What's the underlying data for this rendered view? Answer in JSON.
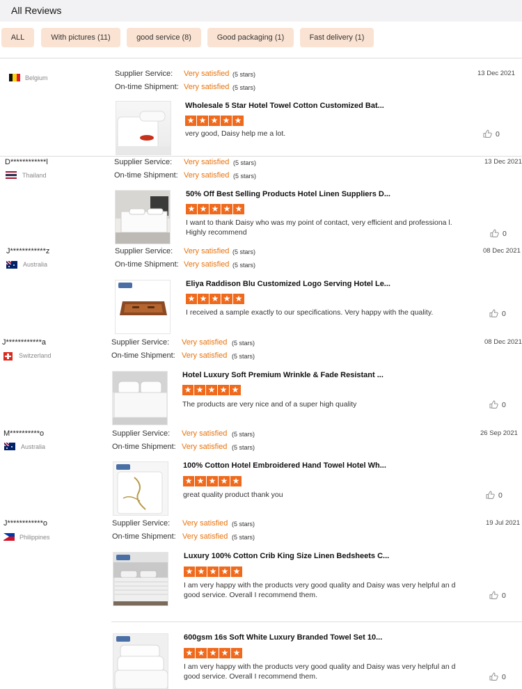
{
  "header": {
    "title": "All Reviews"
  },
  "filters": [
    {
      "label": "ALL"
    },
    {
      "label": "With pictures (11)"
    },
    {
      "label": "good service (8)"
    },
    {
      "label": "Good packaging (1)"
    },
    {
      "label": "Fast delivery (1)"
    }
  ],
  "labels": {
    "supplier_service": "Supplier Service:",
    "ontime_shipment": "On-time Shipment:"
  },
  "reviews": [
    {
      "user": "",
      "country": "Belgium",
      "supplier_rating": "Very satisfied",
      "supplier_stars": "(5 stars)",
      "shipment_rating": "Very satisfied",
      "shipment_stars": "(5 stars)",
      "date": "13 Dec 2021",
      "product_title": "Wholesale 5 Star Hotel Towel Cotton Customized Bat...",
      "review_text": "very good, Daisy help me a lot.",
      "likes": "0"
    },
    {
      "user": "D************l",
      "country": "Thailand",
      "supplier_rating": "Very satisfied",
      "supplier_stars": "(5 stars)",
      "shipment_rating": "Very satisfied",
      "shipment_stars": "(5 stars)",
      "date": "13 Dec 2021",
      "product_title": "50% Off Best Selling Products Hotel Linen Suppliers D...",
      "review_text": "I want to thank Daisy who was my point of contact, very efficient and professiona l. Highly recommend",
      "likes": "0"
    },
    {
      "user": "J************z",
      "country": "Australia",
      "supplier_rating": "Very satisfied",
      "supplier_stars": "(5 stars)",
      "shipment_rating": "Very satisfied",
      "shipment_stars": "(5 stars)",
      "date": "08 Dec 2021",
      "product_title": "Eliya Raddison Blu Customized Logo Serving Hotel Le...",
      "review_text": "I received a sample exactly to our specifications. Very happy with the quality.",
      "likes": "0"
    },
    {
      "user": "J************a",
      "country": "Switzerland",
      "supplier_rating": "Very satisfied",
      "supplier_stars": "(5 stars)",
      "shipment_rating": "Very satisfied",
      "shipment_stars": "(5 stars)",
      "date": "08 Dec 2021",
      "product_title": "Hotel Luxury Soft Premium Wrinkle & Fade Resistant ...",
      "review_text": "The products are very nice and of a super high quality",
      "likes": "0"
    },
    {
      "user": "M**********o",
      "country": "Australia",
      "supplier_rating": "Very satisfied",
      "supplier_stars": "(5 stars)",
      "shipment_rating": "Very satisfied",
      "shipment_stars": "(5 stars)",
      "date": "26 Sep 2021",
      "product_title": "100% Cotton Hotel Embroidered Hand Towel Hotel Wh...",
      "review_text": "great quality product thank you",
      "likes": "0"
    },
    {
      "user": "J************o",
      "country": "Philippines",
      "supplier_rating": "Very satisfied",
      "supplier_stars": "(5 stars)",
      "shipment_rating": "Very satisfied",
      "shipment_stars": "(5 stars)",
      "date": "19 Jul 2021",
      "product_title": "Luxury 100% Cotton Crib King Size Linen Bedsheets C...",
      "review_text": "I am very happy with the products very good quality and Daisy was very helpful an d good service. Overall I recommend them.",
      "likes": "0"
    },
    {
      "product_title": "600gsm 16s Soft White Luxury Branded Towel Set 10...",
      "review_text": "I am very happy with the products very good quality and Daisy was very helpful an d good service. Overall I recommend them.",
      "likes": "0"
    }
  ],
  "star_glyph": "★",
  "accent": "#e8720c"
}
